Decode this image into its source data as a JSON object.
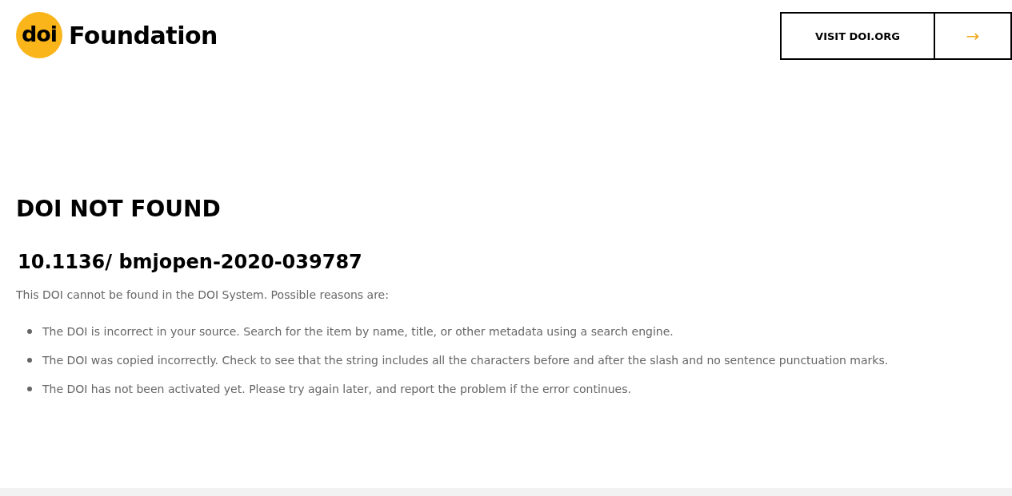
{
  "logo": {
    "mark": "doi",
    "name": "Foundation"
  },
  "header_button": {
    "label": "VISIT DOI.ORG",
    "arrow": "→"
  },
  "title": "DOI NOT FOUND",
  "doi": "10.1136/ bmjopen-2020-039787",
  "intro": "This DOI cannot be found in the DOI System. Possible reasons are:",
  "reasons": [
    "The DOI is incorrect in your source. Search for the item by name, title, or other metadata using a search engine.",
    "The DOI was copied incorrectly. Check to see that the string includes all the characters before and after the slash and no sentence punctuation marks.",
    "The DOI has not been activated yet. Please try again later, and report the problem if the error continues."
  ]
}
